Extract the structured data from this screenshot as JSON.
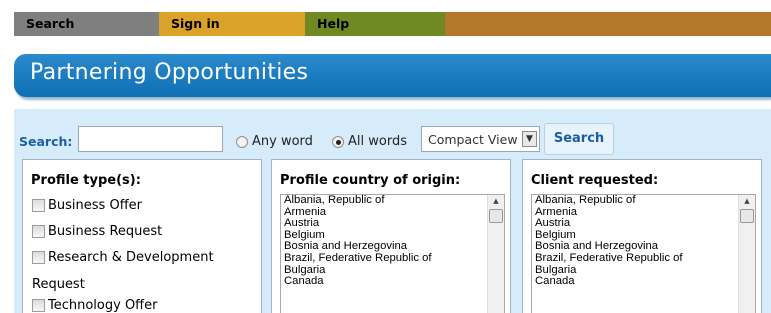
{
  "nav": {
    "search": "Search",
    "signin": "Sign in",
    "help": "Help"
  },
  "banner": {
    "title": "Partnering Opportunities"
  },
  "search": {
    "label": "Search:",
    "input_value": "",
    "input_placeholder": "",
    "radio_any": "Any word",
    "radio_all": "All words",
    "radio_selected": "All words",
    "view_value": "Compact View",
    "button": "Search"
  },
  "profile_types": {
    "title": "Profile type(s):",
    "items": [
      "Business Offer",
      "Business Request",
      "Research & Development",
      "Technology Offer"
    ],
    "wrap_text": "Request"
  },
  "country_box": {
    "title": "Profile country of origin:",
    "options": [
      "Albania, Republic of",
      "Armenia",
      "Austria",
      "Belgium",
      "Bosnia and Herzegovina",
      "Brazil, Federative Republic of",
      "Bulgaria",
      "Canada"
    ]
  },
  "client_box": {
    "title": "Client requested:",
    "options": [
      "Albania, Republic of",
      "Armenia",
      "Austria",
      "Belgium",
      "Bosnia and Herzegovina",
      "Brazil, Federative Republic of",
      "Bulgaria",
      "Canada"
    ]
  },
  "colors": {
    "nav_search": "#7f7f7f",
    "nav_signin": "#dba22a",
    "nav_help": "#6f8a22",
    "nav_filler": "#b3782b",
    "banner": "#1a7cc0",
    "panel": "#d7ecfa",
    "link_blue": "#1a5fa4"
  },
  "icons": {
    "select_arrow": "chevron-down-icon",
    "scroll_up": "scroll-up-arrow-icon"
  }
}
